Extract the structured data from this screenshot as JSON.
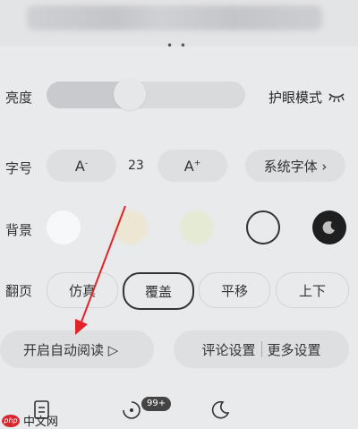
{
  "brightness": {
    "label": "亮度",
    "level": 0.42,
    "eye_mode_label": "护眼模式"
  },
  "font": {
    "label": "字号",
    "decrease_label": "A",
    "decrease_sup": "-",
    "increase_label": "A",
    "increase_sup": "+",
    "value": "23",
    "system_font_label": "系统字体 ›"
  },
  "background": {
    "label": "背景",
    "swatches": [
      {
        "name": "white",
        "color": "#f7f8fa"
      },
      {
        "name": "cream",
        "color": "#ece6d2"
      },
      {
        "name": "green",
        "color": "#e4ead4"
      },
      {
        "name": "grey",
        "color": "#e9eaec"
      },
      {
        "name": "dark",
        "color": "#1f1f1f"
      }
    ]
  },
  "flip": {
    "label": "翻页",
    "options": [
      "仿真",
      "覆盖",
      "平移",
      "上下"
    ],
    "selected": "覆盖"
  },
  "actions": {
    "auto_read": "开启自动阅读 ▷",
    "comment_settings": "评论设置",
    "more_settings": "更多设置"
  },
  "tabbar": {
    "badge": "99+"
  },
  "watermark": {
    "logo_text": "php",
    "site_text": "中文网"
  },
  "colors": {
    "accent_arrow": "#e0242a"
  }
}
